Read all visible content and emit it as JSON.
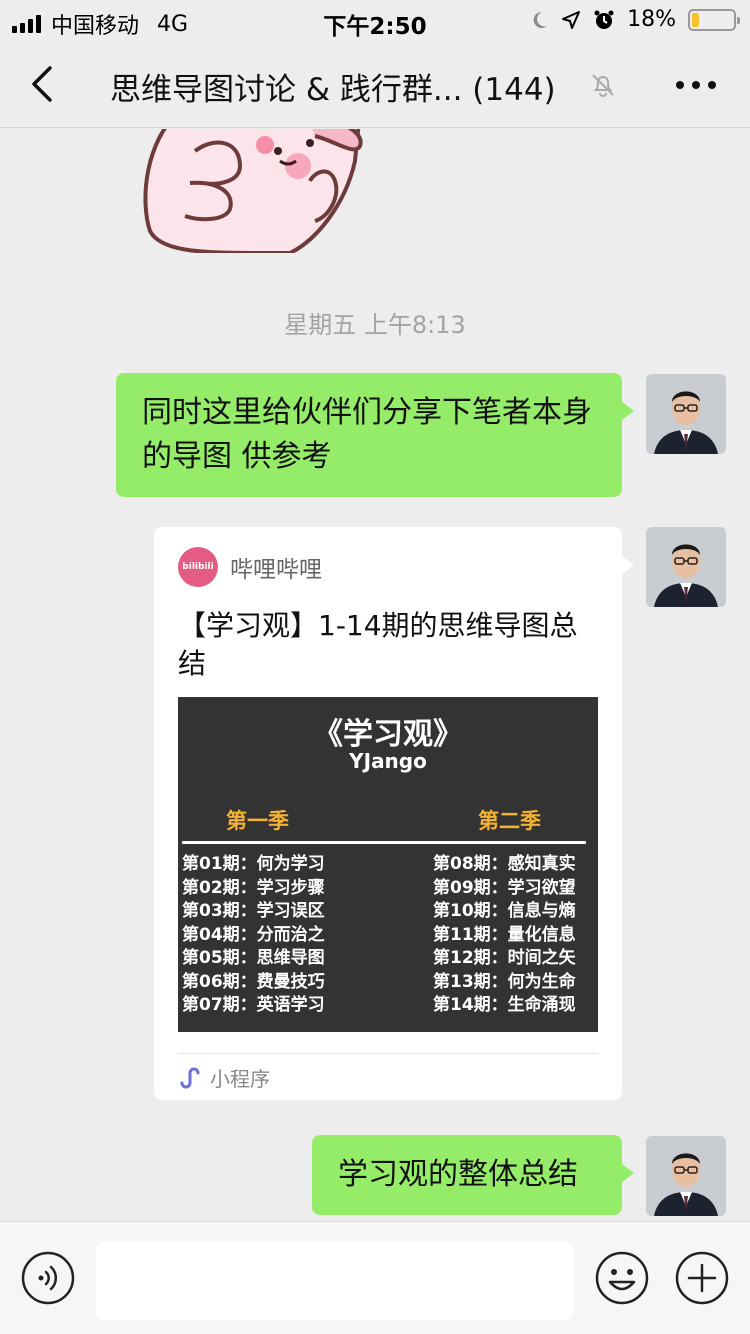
{
  "status_bar": {
    "carrier": "中国移动",
    "network": "4G",
    "time": "下午2:50",
    "battery_percent": "18%",
    "battery_level": 0.18
  },
  "nav": {
    "title": "思维导图讨论 & 践行群... (144)",
    "back_icon": "chevron-left-icon",
    "mute_icon": "bell-slash-icon",
    "more_icon": "ellipsis-icon"
  },
  "chat": {
    "timestamp": "星期五 上午8:13",
    "messages": [
      {
        "type": "text",
        "text": "同时这里给伙伴们分享下笔者本身的导图 供参考"
      },
      {
        "type": "mini_program_card",
        "source": "哔哩哔哩",
        "logo_text": "bilibili",
        "title": "【学习观】1-14期的思维导图总结",
        "thumbnail": {
          "title": "《学习观》",
          "subtitle": "YJango",
          "season1": "第一季",
          "season2": "第二季",
          "episodes_left": [
            "第01期：何为学习",
            "第02期：学习步骤",
            "第03期：学习误区",
            "第04期：分而治之",
            "第05期：思维导图",
            "第06期：费曼技巧",
            "第07期：英语学习"
          ],
          "episodes_right": [
            "第08期：感知真实",
            "第09期：学习欲望",
            "第10期：信息与熵",
            "第11期：量化信息",
            "第12期：时间之矢",
            "第13期：何为生命",
            "第14期：生命涌现"
          ]
        },
        "footer": "小程序"
      },
      {
        "type": "text",
        "text": "学习观的整体总结"
      }
    ]
  },
  "input_bar": {
    "voice_icon": "voice-icon",
    "emoji_icon": "emoji-icon",
    "plus_icon": "plus-icon",
    "placeholder": ""
  },
  "colors": {
    "bubble_green": "#95ec69",
    "background": "#ededed",
    "season_accent": "#f4b233",
    "bilibili_pink": "#e45c84"
  }
}
